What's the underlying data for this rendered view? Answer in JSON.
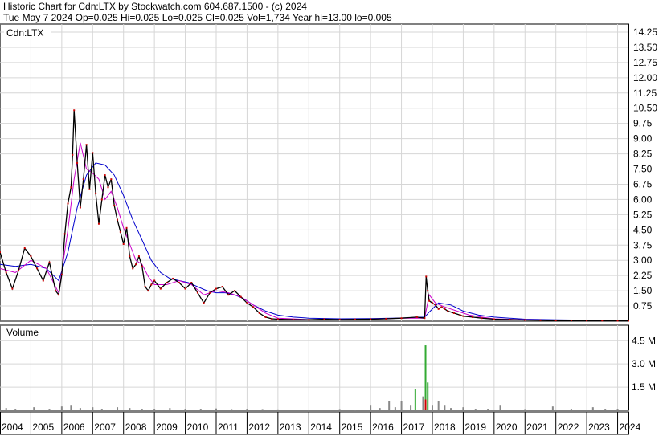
{
  "header": {
    "line1": "Historic Chart for Cdn:LTX by Stockwatch.com 604.687.1500 - (c) 2024",
    "line2": "Tue May  7 2024  Op=0.025  Hi=0.025  Lo=0.025  Cl=0.025  Vol=1,734  Year hi=13.00  lo=0.005"
  },
  "chart_data": [
    {
      "type": "line",
      "symbol_label": "Cdn:LTX",
      "x_tick_labels": [
        "2004",
        "2005",
        "2006",
        "2007",
        "2008",
        "2009",
        "2010",
        "2011",
        "2012",
        "2013",
        "2014",
        "2015",
        "2016",
        "2017",
        "2018",
        "2019",
        "2020",
        "2021",
        "2022",
        "2023",
        "2024"
      ],
      "y_tick_labels": [
        "14.25",
        "13.50",
        "12.75",
        "12.00",
        "11.25",
        "10.50",
        "9.75",
        "9.00",
        "8.25",
        "7.50",
        "6.75",
        "6.00",
        "5.25",
        "4.50",
        "3.75",
        "3.00",
        "2.25",
        "1.50",
        "0.75"
      ],
      "ylim": [
        0,
        14.25
      ],
      "xlim": [
        2004.0,
        2024.35
      ],
      "grid": true,
      "series": [
        {
          "style": "price",
          "color": "#000000",
          "x": [
            2004.0,
            2004.2,
            2004.4,
            2004.6,
            2004.8,
            2005.0,
            2005.2,
            2005.4,
            2005.6,
            2005.8,
            2005.9,
            2006.0,
            2006.1,
            2006.2,
            2006.3,
            2006.35,
            2006.4,
            2006.5,
            2006.6,
            2006.7,
            2006.8,
            2006.9,
            2007.0,
            2007.1,
            2007.2,
            2007.3,
            2007.4,
            2007.5,
            2007.6,
            2007.7,
            2007.8,
            2007.9,
            2008.0,
            2008.1,
            2008.2,
            2008.3,
            2008.4,
            2008.5,
            2008.6,
            2008.7,
            2008.8,
            2008.9,
            2009.0,
            2009.2,
            2009.4,
            2009.6,
            2009.8,
            2010.0,
            2010.2,
            2010.4,
            2010.6,
            2010.8,
            2011.0,
            2011.2,
            2011.4,
            2011.6,
            2011.8,
            2012.0,
            2012.2,
            2012.4,
            2012.6,
            2012.8,
            2013.0,
            2013.5,
            2014.0,
            2014.5,
            2015.0,
            2015.5,
            2016.0,
            2016.5,
            2017.0,
            2017.5,
            2017.75,
            2017.8,
            2017.85,
            2017.9,
            2018.0,
            2018.1,
            2018.2,
            2018.3,
            2018.4,
            2018.5,
            2018.7,
            2018.9,
            2019.0,
            2019.3,
            2019.6,
            2020.0,
            2020.5,
            2021.0,
            2021.5,
            2022.0,
            2022.5,
            2023.0,
            2023.5,
            2024.0,
            2024.35
          ],
          "values": [
            3.4,
            2.4,
            1.6,
            2.5,
            3.6,
            3.2,
            2.6,
            2.0,
            2.9,
            1.5,
            1.3,
            2.3,
            4.3,
            5.8,
            6.6,
            8.2,
            10.4,
            7.8,
            5.6,
            7.0,
            8.7,
            6.5,
            8.3,
            6.3,
            4.8,
            6.0,
            7.2,
            6.6,
            7.0,
            5.7,
            5.0,
            4.4,
            3.8,
            4.6,
            3.2,
            2.6,
            2.8,
            3.2,
            2.7,
            1.7,
            1.5,
            1.8,
            2.0,
            1.6,
            1.9,
            2.1,
            1.9,
            1.6,
            1.9,
            1.4,
            0.9,
            1.4,
            1.6,
            1.7,
            1.3,
            1.5,
            1.2,
            0.9,
            0.7,
            0.4,
            0.2,
            0.12,
            0.1,
            0.08,
            0.07,
            0.1,
            0.08,
            0.09,
            0.1,
            0.12,
            0.15,
            0.2,
            0.15,
            2.2,
            1.5,
            1.0,
            0.9,
            0.8,
            0.6,
            0.7,
            0.6,
            0.5,
            0.4,
            0.3,
            0.25,
            0.2,
            0.15,
            0.1,
            0.08,
            0.06,
            0.05,
            0.04,
            0.04,
            0.03,
            0.03,
            0.025,
            0.025
          ]
        },
        {
          "style": "moving-average-short",
          "color": "#cc00cc",
          "x": [
            2004.0,
            2004.5,
            2005.0,
            2005.5,
            2005.9,
            2006.2,
            2006.4,
            2006.6,
            2006.8,
            2007.0,
            2007.2,
            2007.4,
            2007.6,
            2007.8,
            2008.0,
            2008.2,
            2008.4,
            2008.6,
            2008.8,
            2009.0,
            2009.4,
            2009.8,
            2010.2,
            2010.6,
            2011.0,
            2011.4,
            2011.8,
            2012.2,
            2012.6,
            2013.0,
            2014.0,
            2015.0,
            2016.0,
            2017.0,
            2017.75,
            2017.9,
            2018.1,
            2018.4,
            2018.8,
            2019.2,
            2019.6,
            2020.0,
            2021.0,
            2022.0,
            2023.0,
            2024.35
          ],
          "values": [
            2.6,
            2.4,
            3.0,
            2.6,
            1.4,
            4.5,
            7.0,
            8.8,
            7.5,
            7.3,
            7.0,
            6.0,
            6.4,
            5.6,
            4.6,
            3.8,
            3.0,
            2.8,
            2.2,
            1.8,
            1.8,
            2.0,
            1.8,
            1.3,
            1.5,
            1.4,
            1.2,
            0.8,
            0.4,
            0.15,
            0.08,
            0.08,
            0.1,
            0.15,
            0.15,
            1.3,
            0.9,
            0.7,
            0.5,
            0.3,
            0.2,
            0.12,
            0.07,
            0.05,
            0.04,
            0.03
          ]
        },
        {
          "style": "moving-average-long",
          "color": "#0000cc",
          "x": [
            2004.0,
            2004.5,
            2005.0,
            2005.5,
            2005.9,
            2006.2,
            2006.5,
            2006.8,
            2007.1,
            2007.4,
            2007.7,
            2008.0,
            2008.3,
            2008.6,
            2008.9,
            2009.2,
            2009.5,
            2009.8,
            2010.1,
            2010.4,
            2010.7,
            2011.0,
            2011.3,
            2011.6,
            2011.9,
            2012.2,
            2012.6,
            2013.0,
            2013.5,
            2014.0,
            2015.0,
            2016.0,
            2017.0,
            2017.75,
            2017.9,
            2018.2,
            2018.6,
            2019.0,
            2019.5,
            2020.0,
            2021.0,
            2022.0,
            2023.0,
            2024.35
          ],
          "values": [
            2.8,
            2.7,
            2.8,
            2.6,
            2.0,
            3.4,
            5.6,
            7.2,
            7.8,
            7.7,
            7.2,
            6.2,
            5.0,
            4.0,
            3.0,
            2.4,
            2.1,
            2.0,
            1.9,
            1.7,
            1.5,
            1.4,
            1.4,
            1.3,
            1.1,
            0.8,
            0.5,
            0.3,
            0.2,
            0.15,
            0.12,
            0.13,
            0.16,
            0.2,
            0.45,
            0.9,
            0.8,
            0.5,
            0.3,
            0.2,
            0.1,
            0.07,
            0.05,
            0.035
          ]
        }
      ]
    },
    {
      "type": "bar",
      "panel_label": "Volume",
      "y_tick_labels": [
        "4.5 M",
        "3.0 M",
        "1.5 M"
      ],
      "ylim": [
        0,
        5.5
      ],
      "unit": "M",
      "series": [
        {
          "style": "volume",
          "color": "#888888",
          "x": [
            2004.2,
            2004.5,
            2005.1,
            2005.6,
            2006.0,
            2006.3,
            2006.6,
            2007.0,
            2007.3,
            2007.8,
            2008.2,
            2008.6,
            2009.0,
            2009.5,
            2010.0,
            2010.5,
            2011.0,
            2011.5,
            2012.0,
            2012.5,
            2013.0,
            2014.0,
            2015.0,
            2015.5,
            2016.0,
            2016.3,
            2016.6,
            2016.8,
            2017.0,
            2017.3,
            2017.45,
            2017.7,
            2017.78,
            2017.85,
            2018.0,
            2018.2,
            2018.4,
            2018.6,
            2019.0,
            2019.4,
            2019.8,
            2020.2,
            2021.0,
            2021.9,
            2022.5,
            2023.2,
            2023.6,
            2024.0
          ],
          "values": [
            0.15,
            0.1,
            0.2,
            0.1,
            0.25,
            0.3,
            0.15,
            0.2,
            0.1,
            0.2,
            0.15,
            0.1,
            0.1,
            0.15,
            0.1,
            0.1,
            0.12,
            0.08,
            0.1,
            0.08,
            0.06,
            0.05,
            0.08,
            0.05,
            0.3,
            0.15,
            0.6,
            0.2,
            0.6,
            0.3,
            1.4,
            0.9,
            4.2,
            1.8,
            0.3,
            0.6,
            0.3,
            0.15,
            0.2,
            0.1,
            0.1,
            0.3,
            0.08,
            0.25,
            0.1,
            0.2,
            0.1,
            0.1
          ]
        }
      ]
    }
  ]
}
